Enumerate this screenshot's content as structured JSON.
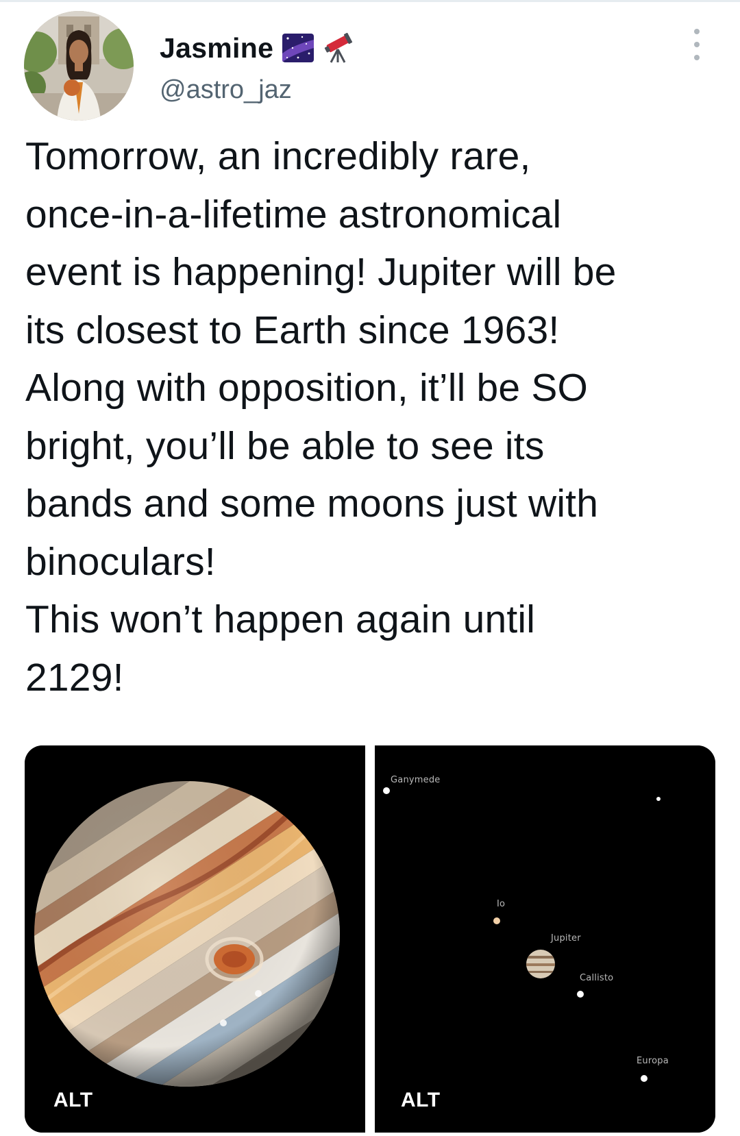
{
  "tweet": {
    "author": {
      "display_name": "Jasmine",
      "name_emojis": [
        "milky-way-icon",
        "telescope-icon"
      ],
      "handle": "@astro_jaz"
    },
    "text": "Tomorrow, an incredibly rare,\nonce-in-a-lifetime astronomical\nevent is happening! Jupiter will be\nits closest to Earth since 1963!\nAlong with opposition, it’ll be SO\nbright, you’ll be able to see its\nbands and some moons just with\nbinoculars!\nThis won’t happen again until\n2129!",
    "media": [
      {
        "alt_label": "ALT",
        "subject": "jupiter-image"
      },
      {
        "alt_label": "ALT",
        "subject": "jupiter-moons-image",
        "labels": {
          "ganymede": "Ganymede",
          "io": "Io",
          "jupiter": "Jupiter",
          "callisto": "Callisto",
          "europa": "Europa"
        }
      }
    ]
  }
}
